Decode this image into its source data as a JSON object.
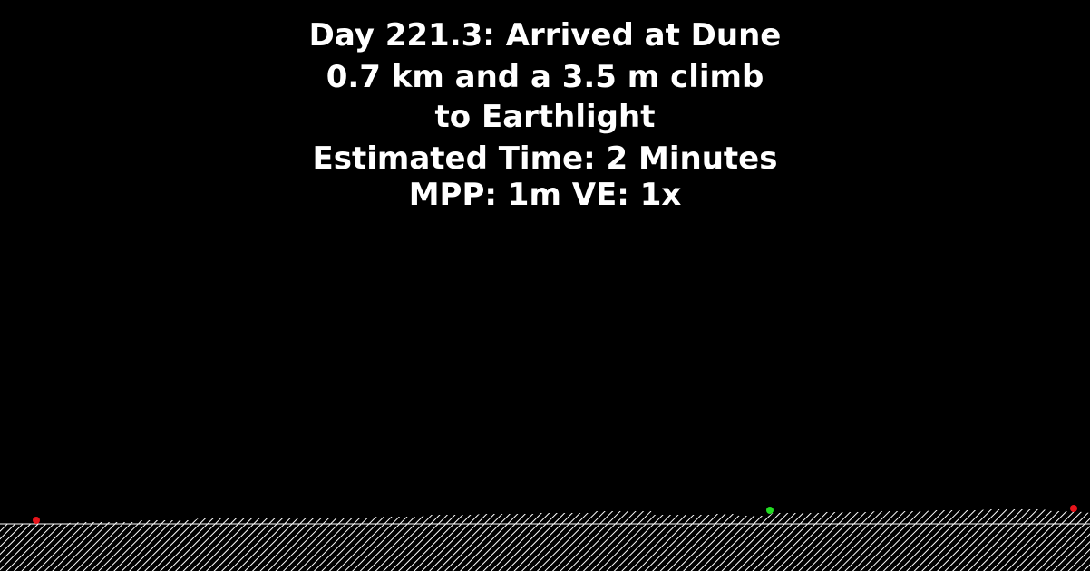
{
  "header": {
    "line1": "Day 221.3: Arrived at Dune",
    "line2": "0.7 km and a 3.5 m climb",
    "line3": "to Earthlight",
    "line4": "Estimated Time: 2 Minutes",
    "line5": "MPP: 1m VE: 1x"
  },
  "colors": {
    "background": "#000000",
    "text": "#ffffff",
    "terrain_hatch": "#ffffff",
    "marker_red": "#e8141b",
    "marker_green": "#22dd22"
  },
  "markers": [
    {
      "name": "start-marker",
      "color": "red"
    },
    {
      "name": "current-position-marker",
      "color": "green"
    },
    {
      "name": "destination-marker",
      "color": "red"
    }
  ]
}
